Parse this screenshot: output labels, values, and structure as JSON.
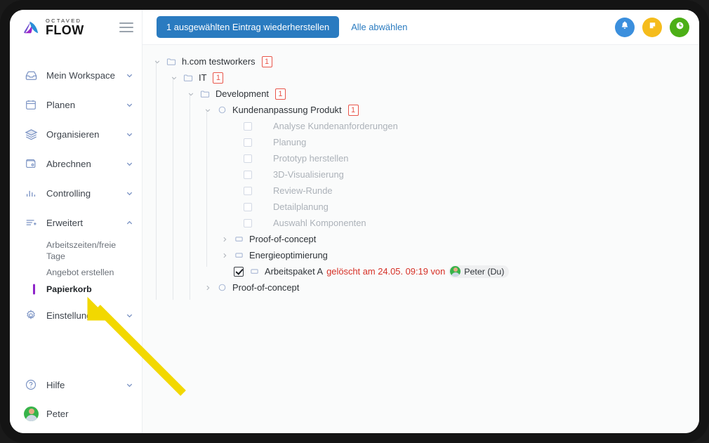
{
  "brand": {
    "top_text": "OCTAVED",
    "bottom_text": "FLOW",
    "menu_icon": "hamburger-icon"
  },
  "sidebar": {
    "items": [
      {
        "label": "Mein Workspace",
        "icon": "inbox-icon",
        "chevron": "chevron-down-icon"
      },
      {
        "label": "Planen",
        "icon": "calendar-icon",
        "chevron": "chevron-down-icon"
      },
      {
        "label": "Organisieren",
        "icon": "layers-icon",
        "chevron": "chevron-down-icon"
      },
      {
        "label": "Abrechnen",
        "icon": "wallet-icon",
        "chevron": "chevron-down-icon"
      },
      {
        "label": "Controlling",
        "icon": "bar-chart-icon",
        "chevron": "chevron-down-icon"
      },
      {
        "label": "Erweitert",
        "icon": "list-plus-icon",
        "chevron": "chevron-up-icon"
      }
    ],
    "sub_items": [
      {
        "label": "Arbeitszeiten/freie Tage",
        "active": false
      },
      {
        "label": "Angebot erstellen",
        "active": false
      },
      {
        "label": "Papierkorb",
        "active": true
      }
    ],
    "settings": {
      "label": "Einstellungen",
      "icon": "gear-icon",
      "chevron": "chevron-down-icon"
    },
    "help": {
      "label": "Hilfe",
      "icon": "question-circle-icon",
      "chevron": "chevron-down-icon"
    },
    "user": {
      "label": "Peter",
      "avatar": "user-avatar"
    },
    "active_marker_color": "#8e24c9"
  },
  "topbar": {
    "restore_button": "1 ausgewählten Eintrag wiederherstellen",
    "deselect_link": "Alle abwählen",
    "actions": [
      {
        "name": "notifications-button",
        "icon": "bell-icon",
        "color": "#3b8fdd"
      },
      {
        "name": "notes-button",
        "icon": "note-icon",
        "color": "#f5bc1c"
      },
      {
        "name": "time-tracking-button",
        "icon": "clock-icon",
        "color": "#4caf16"
      }
    ]
  },
  "tree": {
    "rows": [
      {
        "indent": 0,
        "toggle": "chevron-down-icon",
        "node_icon": "folder-icon",
        "label": "h.com testworkers",
        "badge": "1",
        "dim": false,
        "checkbox": "none"
      },
      {
        "indent": 1,
        "toggle": "chevron-down-icon",
        "node_icon": "folder-icon",
        "label": "IT",
        "badge": "1",
        "dim": false,
        "checkbox": "none"
      },
      {
        "indent": 2,
        "toggle": "chevron-down-icon",
        "node_icon": "folder-icon",
        "label": "Development",
        "badge": "1",
        "dim": false,
        "checkbox": "none"
      },
      {
        "indent": 3,
        "toggle": "chevron-down-icon",
        "node_icon": "circle-icon",
        "label": "Kundenanpassung Produkt",
        "badge": "1",
        "dim": false,
        "checkbox": "none"
      },
      {
        "indent": 4,
        "toggle": "none",
        "node_icon": "none",
        "label": "Analyse Kundenanforderungen",
        "badge": "",
        "dim": true,
        "checkbox": "unchecked"
      },
      {
        "indent": 4,
        "toggle": "none",
        "node_icon": "none",
        "label": "Planung",
        "badge": "",
        "dim": true,
        "checkbox": "unchecked"
      },
      {
        "indent": 4,
        "toggle": "none",
        "node_icon": "none",
        "label": "Prototyp herstellen",
        "badge": "",
        "dim": true,
        "checkbox": "unchecked"
      },
      {
        "indent": 4,
        "toggle": "none",
        "node_icon": "none",
        "label": "3D-Visualisierung",
        "badge": "",
        "dim": true,
        "checkbox": "unchecked"
      },
      {
        "indent": 4,
        "toggle": "none",
        "node_icon": "none",
        "label": "Review-Runde",
        "badge": "",
        "dim": true,
        "checkbox": "unchecked"
      },
      {
        "indent": 4,
        "toggle": "none",
        "node_icon": "none",
        "label": "Detailplanung",
        "badge": "",
        "dim": true,
        "checkbox": "unchecked"
      },
      {
        "indent": 4,
        "toggle": "none",
        "node_icon": "none",
        "label": "Auswahl Komponenten",
        "badge": "",
        "dim": true,
        "checkbox": "unchecked"
      },
      {
        "indent": 4,
        "toggle": "chevron-right-icon",
        "node_icon": "task-icon",
        "label": "Proof-of-concept",
        "badge": "",
        "dim": false,
        "checkbox": "none"
      },
      {
        "indent": 4,
        "toggle": "chevron-right-icon",
        "node_icon": "task-icon",
        "label": "Energieoptimierung",
        "badge": "",
        "dim": false,
        "checkbox": "none"
      },
      {
        "indent": 4,
        "toggle": "none",
        "node_icon": "task-icon",
        "label": "Arbeitspaket A",
        "badge": "",
        "dim": false,
        "checkbox": "checked",
        "deleted_note": "gelöscht am 24.05. 09:19 von",
        "deleted_by": "Peter (Du)"
      },
      {
        "indent": 3,
        "toggle": "chevron-right-icon",
        "node_icon": "circle-icon",
        "label": "Proof-of-concept",
        "badge": "",
        "dim": false,
        "checkbox": "none"
      }
    ],
    "badge_color": "#e8554a",
    "deleted_text_color": "#d63026"
  },
  "annotation": {
    "arrow_color": "#f2d800",
    "points_to": "Papierkorb"
  }
}
